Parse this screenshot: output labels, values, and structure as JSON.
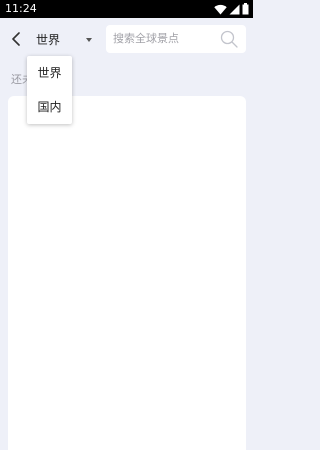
{
  "status_bar": {
    "time": "11:24",
    "icons": [
      "wifi-icon",
      "signal-icon",
      "battery-icon"
    ]
  },
  "header": {
    "back_icon": "chevron-left-icon",
    "region_selected": "世界",
    "search": {
      "placeholder": "搜索全球景点",
      "icon": "search-icon"
    }
  },
  "hint": {
    "text": "还未"
  },
  "dropdown": {
    "options": [
      "世界",
      "国内"
    ]
  },
  "colors": {
    "page_background": "#eef0f8",
    "panel_background": "#ffffff",
    "status_bar_background": "#000000",
    "placeholder_text": "#a2a2a8"
  }
}
